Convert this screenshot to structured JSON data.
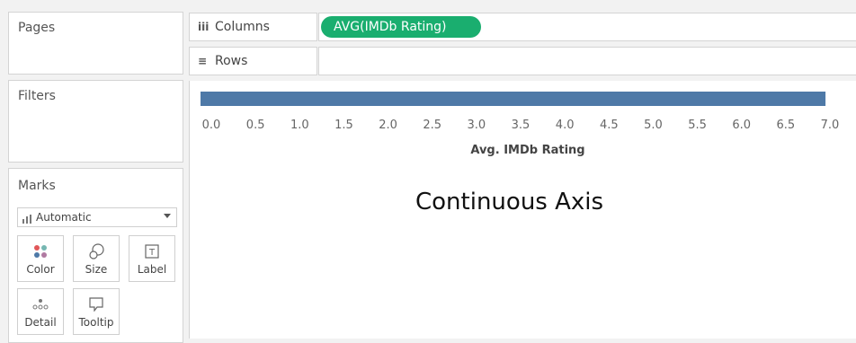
{
  "pages": {
    "title": "Pages"
  },
  "filters": {
    "title": "Filters"
  },
  "marks": {
    "title": "Marks",
    "mark_type": "Automatic",
    "buttons": [
      {
        "label": "Color",
        "icon": "color-dots-icon"
      },
      {
        "label": "Size",
        "icon": "size-icon"
      },
      {
        "label": "Label",
        "icon": "label-icon"
      },
      {
        "label": "Detail",
        "icon": "detail-icon"
      },
      {
        "label": "Tooltip",
        "icon": "tooltip-icon"
      }
    ]
  },
  "shelves": {
    "columns": {
      "label": "Columns",
      "icon_glyph": "iii",
      "pill": "AVG(IMDb Rating)"
    },
    "rows": {
      "label": "Rows",
      "icon_glyph": "≡"
    }
  },
  "colors": {
    "bar": "#4e79a7",
    "pill": "#1aae6f"
  },
  "view": {
    "caption": "Continuous Axis"
  },
  "chart_data": {
    "type": "bar",
    "orientation": "horizontal",
    "categories": [
      ""
    ],
    "values": [
      6.95
    ],
    "xlabel": "Avg. IMDb Rating",
    "xlim": [
      0,
      7.2
    ],
    "ticks": [
      "0.0",
      "0.5",
      "1.0",
      "1.5",
      "2.0",
      "2.5",
      "3.0",
      "3.5",
      "4.0",
      "4.5",
      "5.0",
      "5.5",
      "6.0",
      "6.5",
      "7.0"
    ],
    "grid": false
  }
}
